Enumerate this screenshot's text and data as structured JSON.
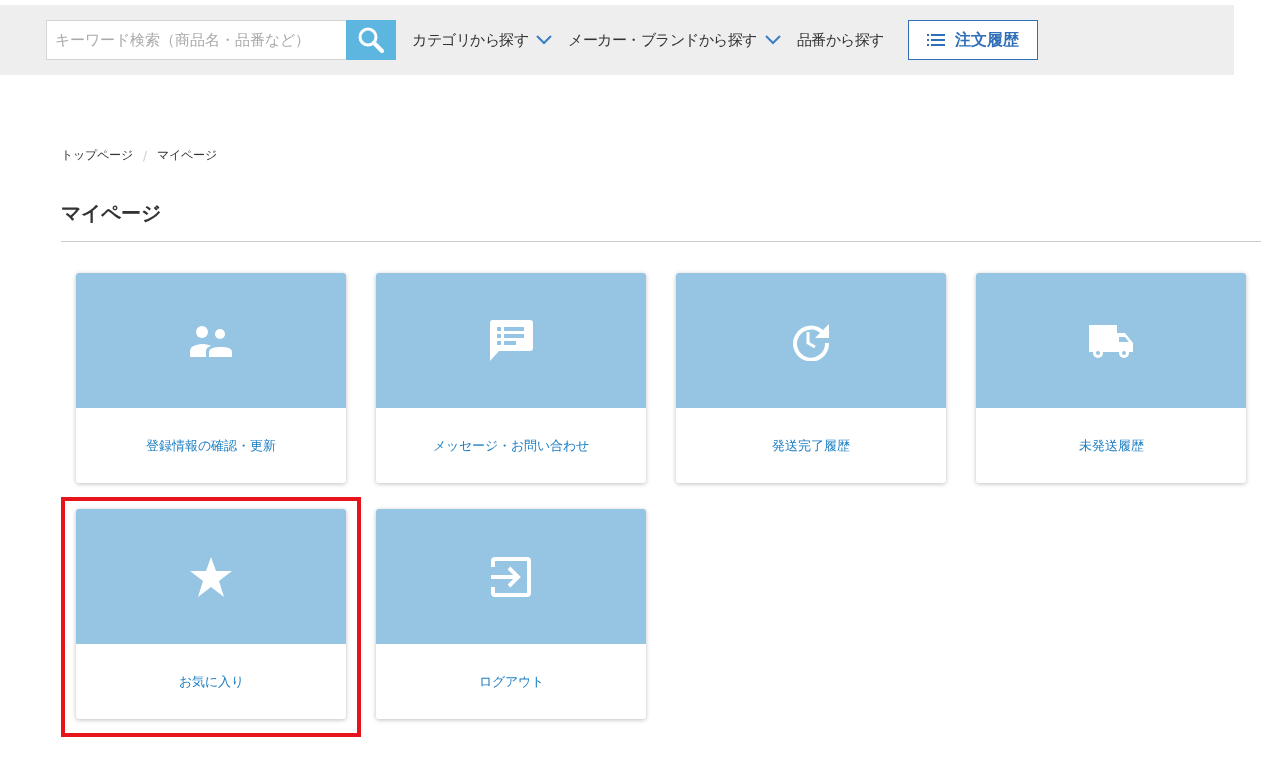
{
  "header": {
    "search": {
      "placeholder": "キーワード検索（商品名・品番など）"
    },
    "nav": [
      {
        "label": "カテゴリから探す",
        "dropdown": true
      },
      {
        "label": "メーカー・ブランドから探す",
        "dropdown": true
      },
      {
        "label": "品番から探す",
        "dropdown": false
      }
    ],
    "order_history_button": "注文履歴"
  },
  "breadcrumb": [
    "トップページ",
    "マイページ"
  ],
  "breadcrumb_separator": "/",
  "title": "マイページ",
  "cards": [
    {
      "kind": "people",
      "label": "登録情報の確認・更新",
      "highlighted": false
    },
    {
      "kind": "message",
      "label": "メッセージ・お問い合わせ",
      "highlighted": false
    },
    {
      "kind": "history",
      "label": "発送完了履歴",
      "highlighted": false
    },
    {
      "kind": "truck",
      "label": "未発送履歴",
      "highlighted": false
    },
    {
      "kind": "star",
      "label": "お気に入り",
      "highlighted": true
    },
    {
      "kind": "logout",
      "label": "ログアウト",
      "highlighted": false
    }
  ]
}
